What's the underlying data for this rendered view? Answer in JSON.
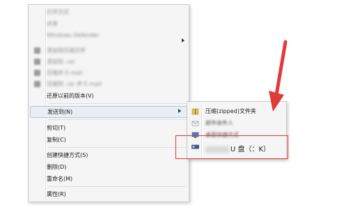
{
  "context_menu": {
    "items": [
      {
        "label": "打开方式",
        "blurred": true,
        "arrow": false
      },
      {
        "label": "共享",
        "blurred": true,
        "arrow": true
      },
      {
        "label": "Windows Defender",
        "blurred": true,
        "arrow": false
      },
      {
        "label": "添加到压缩文件",
        "blurred": true,
        "arrow": false
      },
      {
        "label": "添加到 .rar",
        "blurred": true,
        "arrow": false
      },
      {
        "label": "压缩并 E-mail",
        "blurred": true,
        "arrow": false
      },
      {
        "label": "压缩到 .rar 并 E-mail",
        "blurred": true,
        "arrow": false
      },
      {
        "label": "还原以前的版本(V)",
        "blurred": false,
        "arrow": false
      },
      {
        "label": "发送到(N)",
        "blurred": false,
        "arrow": true,
        "highlight": true
      },
      {
        "label": "剪切(T)",
        "blurred": false
      },
      {
        "label": "复制(C)",
        "blurred": false
      },
      {
        "label": "创建快捷方式(S)",
        "blurred": false
      },
      {
        "label": "删除(D)",
        "blurred": false
      },
      {
        "label": "重命名(M)",
        "blurred": false
      },
      {
        "label": "属性(R)",
        "blurred": false
      }
    ]
  },
  "send_to_menu": {
    "items": [
      {
        "label": "压缩(zipped)文件夹",
        "icon": "zip-folder-icon"
      },
      {
        "label": "邮件收件人",
        "icon": "mail-icon"
      },
      {
        "label": "桌面快捷方式",
        "icon": "desktop-icon"
      },
      {
        "label": "U 盘（：K）",
        "icon": "usb-drive-icon"
      }
    ]
  },
  "annotation": {
    "color": "#e23a3a"
  }
}
